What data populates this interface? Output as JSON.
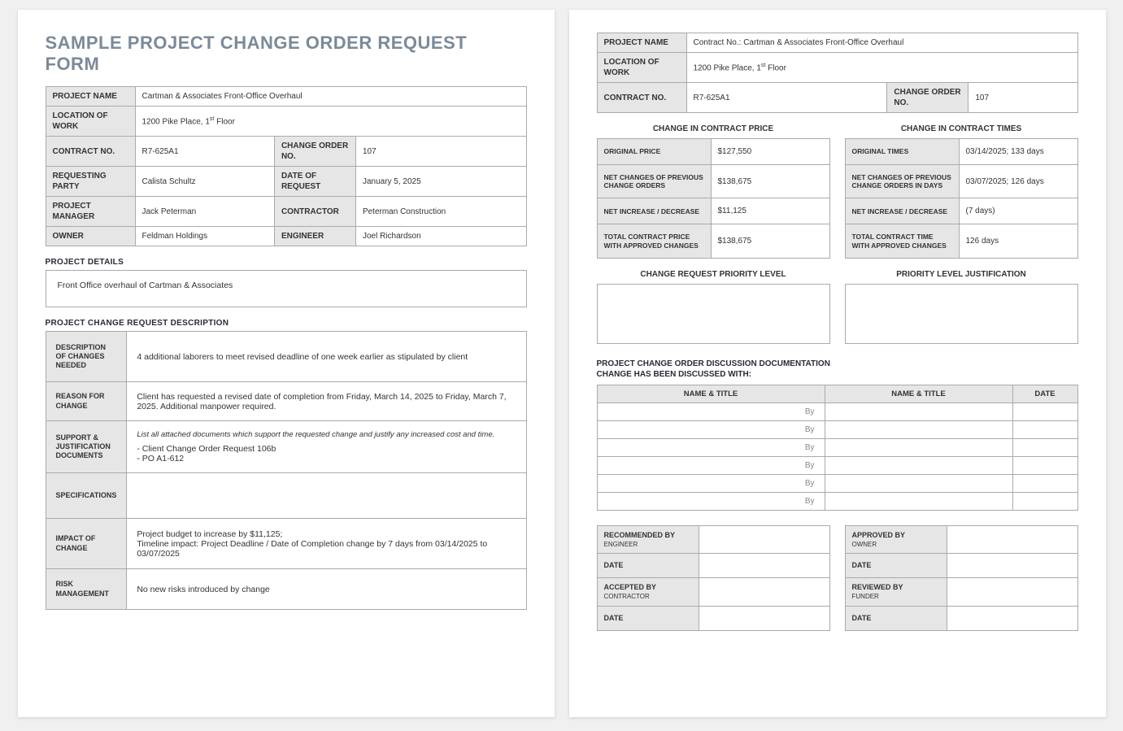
{
  "title": "SAMPLE PROJECT CHANGE ORDER REQUEST FORM",
  "labels": {
    "project_name": "PROJECT NAME",
    "location_of_work": "LOCATION OF WORK",
    "contract_no": "CONTRACT NO.",
    "change_order_no": "CHANGE ORDER NO.",
    "requesting_party": "REQUESTING PARTY",
    "date_of_request": "DATE OF REQUEST",
    "project_manager": "PROJECT MANAGER",
    "contractor": "CONTRACTOR",
    "owner": "OWNER",
    "engineer": "ENGINEER"
  },
  "header": {
    "project_name": "Cartman & Associates Front-Office Overhaul",
    "location_of_work_pre": "1200 Pike Place, 1",
    "location_of_work_suf": " Floor",
    "location_sup": "st",
    "contract_no": "R7-625A1",
    "change_order_no": "107",
    "requesting_party": "Calista Schultz",
    "date_of_request": "January 5, 2025",
    "project_manager": "Jack Peterman",
    "contractor": "Peterman Construction",
    "owner": "Feldman Holdings",
    "engineer": "Joel Richardson"
  },
  "sections": {
    "project_details": "PROJECT DETAILS",
    "project_details_text": "Front Office overhaul of Cartman & Associates",
    "pcrd": "PROJECT CHANGE REQUEST DESCRIPTION"
  },
  "desc": {
    "d1_label": "DESCRIPTION OF CHANGES NEEDED",
    "d1_val": "4 additional laborers to meet revised deadline of one week earlier as stipulated by client",
    "d2_label": "REASON FOR CHANGE",
    "d2_val": "Client has requested a revised date of completion from Friday, March 14, 2025 to Friday, March 7, 2025.  Additional manpower required.",
    "d3_label": "SUPPORT & JUSTIFICATION DOCUMENTS",
    "d3_hint": "List all attached documents which support the requested change and justify any increased cost and time.",
    "d3_line1": "- Client Change Order Request 106b",
    "d3_line2": "- PO A1-612",
    "d4_label": "SPECIFICATIONS",
    "d5_label": "IMPACT OF CHANGE",
    "d5_line1": "Project budget to increase by $11,125;",
    "d5_line2": "Timeline impact: Project Deadline / Date of Completion change by 7 days from 03/14/2025 to 03/07/2025",
    "d6_label": "RISK MANAGEMENT",
    "d6_val": "No new risks introduced by change"
  },
  "p2_header": {
    "project_name": "Contract No.: Cartman & Associates Front-Office Overhaul"
  },
  "price_section": {
    "title": "CHANGE IN CONTRACT PRICE",
    "r1_label": "ORIGINAL PRICE",
    "r1_val": "$127,550",
    "r2_label": "NET CHANGES OF PREVIOUS CHANGE ORDERS",
    "r2_val": "$138,675",
    "r3_label": "NET INCREASE / DECREASE",
    "r3_val": "$11,125",
    "r4_label": "TOTAL CONTRACT PRICE WITH APPROVED CHANGES",
    "r4_val": "$138,675"
  },
  "time_section": {
    "title": "CHANGE IN CONTRACT TIMES",
    "r1_label": "ORIGINAL TIMES",
    "r1_val": "03/14/2025; 133 days",
    "r2_label": "NET CHANGES OF PREVIOUS CHANGE ORDERS IN DAYS",
    "r2_val": "03/07/2025; 126 days",
    "r3_label": "NET INCREASE / DECREASE",
    "r3_val": "(7 days)",
    "r4_label": "TOTAL CONTRACT TIME WITH APPROVED CHANGES",
    "r4_val": "126 days"
  },
  "priority": {
    "left_title": "CHANGE REQUEST PRIORITY LEVEL",
    "right_title": "PRIORITY LEVEL JUSTIFICATION"
  },
  "discussion": {
    "title1": "PROJECT CHANGE ORDER DISCUSSION DOCUMENTATION",
    "title2": "CHANGE HAS BEEN DISCUSSED WITH:",
    "col_name": "NAME & TITLE",
    "col_date": "DATE",
    "by": "By"
  },
  "sig": {
    "recommended": "RECOMMENDED BY",
    "engineer": "ENGINEER",
    "approved": "APPROVED BY",
    "owner": "OWNER",
    "date": "DATE",
    "accepted": "ACCEPTED BY",
    "contractor": "CONTRACTOR",
    "reviewed": "REVIEWED BY",
    "funder": "FUNDER"
  }
}
